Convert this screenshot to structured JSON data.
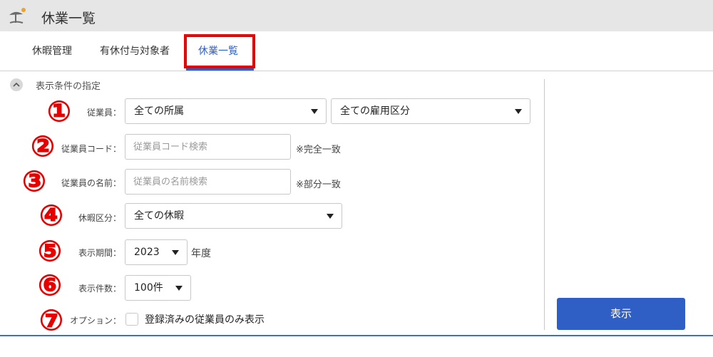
{
  "header": {
    "title": "休業一覧",
    "icon": "beach-umbrella-icon"
  },
  "tabs": [
    {
      "label": "休暇管理",
      "active": false
    },
    {
      "label": "有休付与対象者",
      "active": false
    },
    {
      "label": "休業一覧",
      "active": true
    }
  ],
  "filters": {
    "section_title": "表示条件の指定",
    "employee": {
      "number": "①",
      "label": "従業員：",
      "department_value": "全ての所属",
      "employment_type_value": "全ての雇用区分"
    },
    "employee_code": {
      "number": "②",
      "label": "従業員コード：",
      "placeholder": "従業員コード検索",
      "value": "",
      "note": "※完全一致"
    },
    "employee_name": {
      "number": "③",
      "label": "従業員の名前：",
      "placeholder": "従業員の名前検索",
      "value": "",
      "note": "※部分一致"
    },
    "leave_type": {
      "number": "④",
      "label": "休暇区分：",
      "value": "全ての休暇"
    },
    "period": {
      "number": "⑤",
      "label": "表示期間：",
      "value": "2023",
      "suffix": "年度"
    },
    "count": {
      "number": "⑥",
      "label": "表示件数：",
      "value": "100件"
    },
    "option": {
      "number": "⑦",
      "label": "オプション：",
      "checkbox_label": "登録済みの従業員のみ表示",
      "checked": false
    }
  },
  "actions": {
    "show_label": "表示"
  },
  "colors": {
    "accent": "#2f5fc4",
    "highlight": "#e60000"
  }
}
